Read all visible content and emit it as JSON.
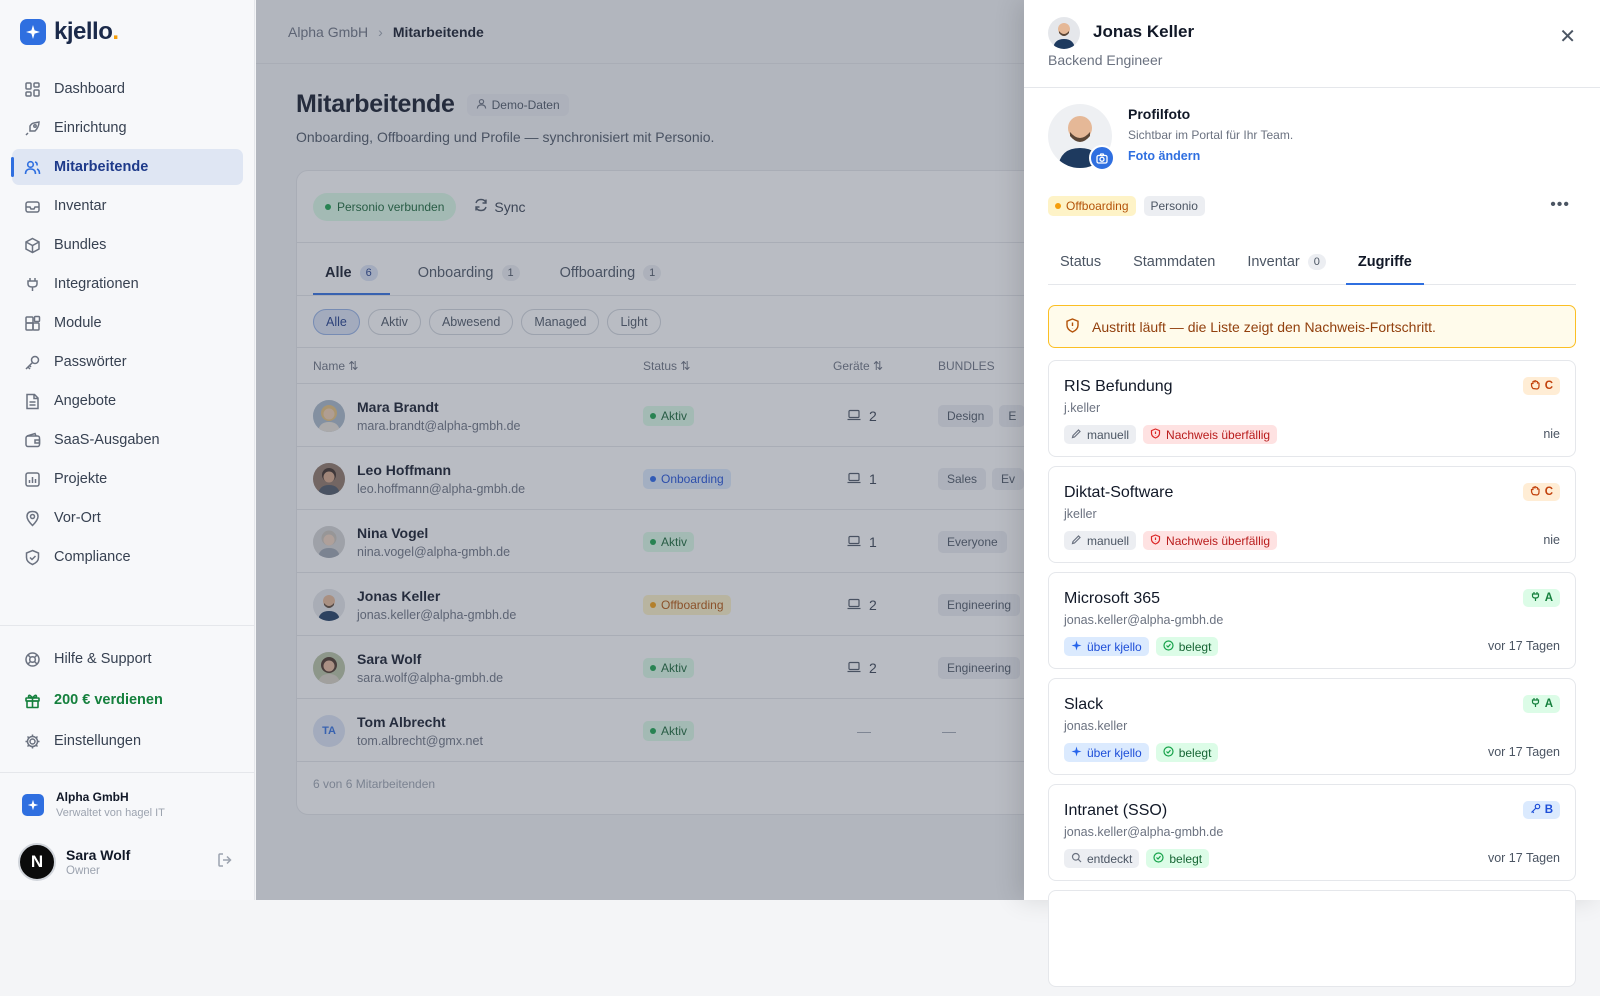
{
  "app": {
    "name": "kjello",
    "accent": "#2f6fe0"
  },
  "sidebar": {
    "items": [
      {
        "label": "Dashboard",
        "icon": "grid-icon"
      },
      {
        "label": "Einrichtung",
        "icon": "rocket-icon"
      },
      {
        "label": "Mitarbeitende",
        "icon": "users-icon",
        "active": true
      },
      {
        "label": "Inventar",
        "icon": "inbox-icon"
      },
      {
        "label": "Bundles",
        "icon": "package-icon"
      },
      {
        "label": "Integrationen",
        "icon": "plug-icon"
      },
      {
        "label": "Module",
        "icon": "blocks-icon"
      },
      {
        "label": "Passwörter",
        "icon": "key-icon"
      },
      {
        "label": "Angebote",
        "icon": "file-icon"
      },
      {
        "label": "SaaS-Ausgaben",
        "icon": "wallet-icon"
      },
      {
        "label": "Projekte",
        "icon": "chart-icon"
      },
      {
        "label": "Vor-Ort",
        "icon": "pin-icon"
      },
      {
        "label": "Compliance",
        "icon": "shield-icon"
      }
    ],
    "bottom": [
      {
        "label": "Hilfe & Support",
        "icon": "lifebuoy-icon"
      },
      {
        "label": "200 € verdienen",
        "icon": "gift-icon"
      },
      {
        "label": "Einstellungen",
        "icon": "gear-icon"
      }
    ],
    "org": {
      "name": "Alpha GmbH",
      "sub": "Verwaltet von hagel IT"
    },
    "user": {
      "name": "Sara Wolf",
      "role": "Owner",
      "initial": "N"
    }
  },
  "breadcrumb": {
    "parent": "Alpha GmbH",
    "current": "Mitarbeitende"
  },
  "page": {
    "title": "Mitarbeitende",
    "badge": "Demo-Daten",
    "subtitle": "Onboarding, Offboarding und Profile — synchronisiert mit Personio."
  },
  "card": {
    "connected": "Personio verbunden",
    "sync": "Sync",
    "tabs": [
      {
        "label": "Alle",
        "count": "6"
      },
      {
        "label": "Onboarding",
        "count": "1"
      },
      {
        "label": "Offboarding",
        "count": "1"
      }
    ],
    "filters": [
      "Alle",
      "Aktiv",
      "Abwesend",
      "Managed",
      "Light"
    ],
    "columns": {
      "name": "Name",
      "status": "Status",
      "devices": "Geräte",
      "bundles": "BUNDLES"
    },
    "rows": [
      {
        "name": "Mara Brandt",
        "email": "mara.brandt@alpha-gmbh.de",
        "status": "Aktiv",
        "devices": "2",
        "bundles": [
          "Design",
          "E"
        ]
      },
      {
        "name": "Leo Hoffmann",
        "email": "leo.hoffmann@alpha-gmbh.de",
        "status": "Onboarding",
        "devices": "1",
        "bundles": [
          "Sales",
          "Ev"
        ]
      },
      {
        "name": "Nina Vogel",
        "email": "nina.vogel@alpha-gmbh.de",
        "status": "Aktiv",
        "devices": "1",
        "bundles": [
          "Everyone"
        ]
      },
      {
        "name": "Jonas Keller",
        "email": "jonas.keller@alpha-gmbh.de",
        "status": "Offboarding",
        "devices": "2",
        "bundles": [
          "Engineering"
        ]
      },
      {
        "name": "Sara Wolf",
        "email": "sara.wolf@alpha-gmbh.de",
        "status": "Aktiv",
        "devices": "2",
        "bundles": [
          "Engineering"
        ]
      },
      {
        "name": "Tom Albrecht",
        "email": "tom.albrecht@gmx.net",
        "status": "Aktiv",
        "devices": "—",
        "bundles": [
          "—"
        ],
        "initials": "TA"
      }
    ],
    "footer": "6 von 6 Mitarbeitenden"
  },
  "drawer": {
    "name": "Jonas Keller",
    "role": "Backend Engineer",
    "photo": {
      "title": "Profilfoto",
      "sub": "Sichtbar im Portal für Ihr Team.",
      "link": "Foto ändern"
    },
    "tags": [
      "Offboarding",
      "Personio"
    ],
    "tabs": [
      {
        "label": "Status"
      },
      {
        "label": "Stammdaten"
      },
      {
        "label": "Inventar",
        "count": "0"
      },
      {
        "label": "Zugriffe",
        "active": true
      }
    ],
    "alert": "Austritt läuft — die Liste zeigt den Nachweis-Fortschritt.",
    "accesses": [
      {
        "name": "RIS Befundung",
        "user": "j.keller",
        "tags": [
          "manuell",
          "Nachweis überfällig"
        ],
        "when": "nie",
        "badge": "C"
      },
      {
        "name": "Diktat-Software",
        "user": "jkeller",
        "tags": [
          "manuell",
          "Nachweis überfällig"
        ],
        "when": "nie",
        "badge": "C"
      },
      {
        "name": "Microsoft 365",
        "user": "jonas.keller@alpha-gmbh.de",
        "tags": [
          "über kjello",
          "belegt"
        ],
        "when": "vor 17 Tagen",
        "badge": "A"
      },
      {
        "name": "Slack",
        "user": "jonas.keller",
        "tags": [
          "über kjello",
          "belegt"
        ],
        "when": "vor 17 Tagen",
        "badge": "A"
      },
      {
        "name": "Intranet (SSO)",
        "user": "jonas.keller@alpha-gmbh.de",
        "tags": [
          "entdeckt",
          "belegt"
        ],
        "when": "vor 17 Tagen",
        "badge": "B"
      }
    ]
  }
}
